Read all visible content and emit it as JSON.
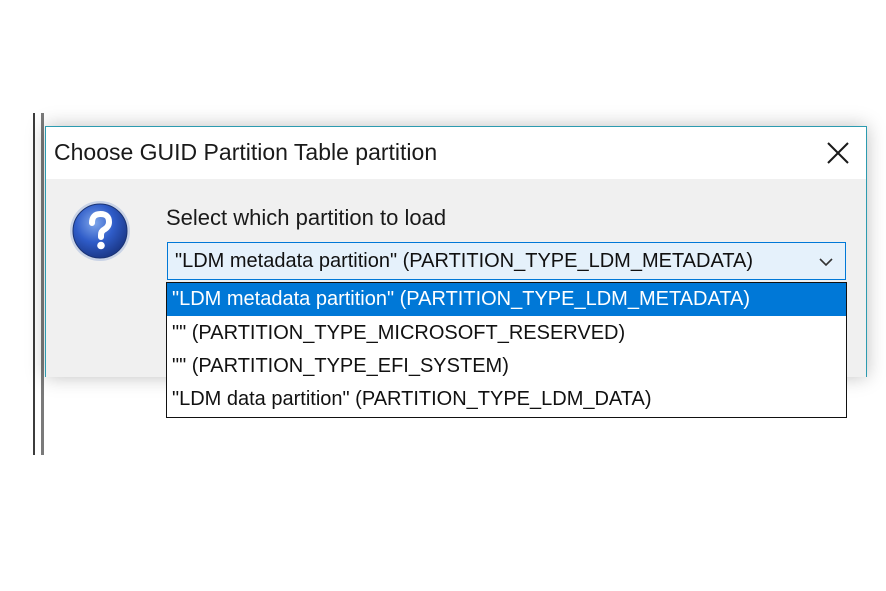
{
  "dialog": {
    "title": "Choose GUID Partition Table partition",
    "close_icon": "close-icon",
    "prompt": "Select which partition to load",
    "icon": "question-icon"
  },
  "combo": {
    "selected_value": "\"LDM metadata partition\" (PARTITION_TYPE_LDM_METADATA)",
    "arrow_icon": "chevron-down-icon"
  },
  "dropdown": {
    "items": [
      {
        "label": "\"LDM metadata partition\" (PARTITION_TYPE_LDM_METADATA)",
        "selected": true
      },
      {
        "label": "\"\" (PARTITION_TYPE_MICROSOFT_RESERVED)",
        "selected": false
      },
      {
        "label": "\"\" (PARTITION_TYPE_EFI_SYSTEM)",
        "selected": false
      },
      {
        "label": "\"LDM data partition\" (PARTITION_TYPE_LDM_DATA)",
        "selected": false
      }
    ]
  },
  "colors": {
    "accent": "#0078d7",
    "dialog_border": "#2c9bb0",
    "client_bg": "#f0f0f0",
    "combo_bg": "#e5f1fb"
  }
}
